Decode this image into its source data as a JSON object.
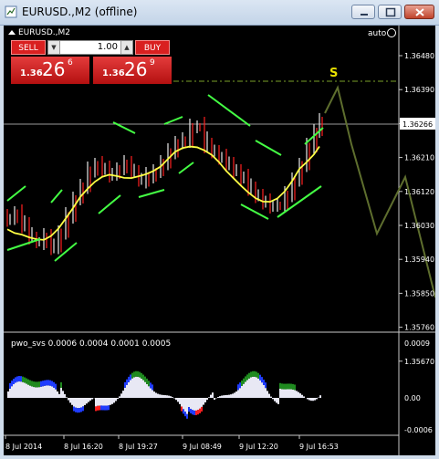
{
  "window": {
    "title": "EURUSD.,M2 (offline)"
  },
  "chart": {
    "symbol_label": "EURUSD.,M2",
    "auto_label": "auto",
    "signal_letter": "S",
    "price_axis": [
      "1.36480",
      "1.36390",
      "1.36300",
      "1.36210",
      "1.36120",
      "1.36030",
      "1.35940",
      "1.35850",
      "1.35760",
      "1.35670"
    ],
    "current_price_label": "1.36266",
    "time_axis": [
      "8 Jul 2014",
      "8 Jul 16:20",
      "8 Jul 19:27",
      "9 Jul 08:49",
      "9 Jul 12:20",
      "9 Jul 16:53"
    ]
  },
  "trade_panel": {
    "sell_label": "SELL",
    "buy_label": "BUY",
    "lot_value": "1.00",
    "sell_price": {
      "big": "1.36",
      "main": "26",
      "sup": "6"
    },
    "buy_price": {
      "big": "1.36",
      "main": "26",
      "sup": "9"
    }
  },
  "indicator": {
    "label": "pwo_svs 0.0006 0.0004 0.0001 0.0005",
    "axis": [
      "0.0009",
      "0.00",
      "-0.0006"
    ]
  }
}
